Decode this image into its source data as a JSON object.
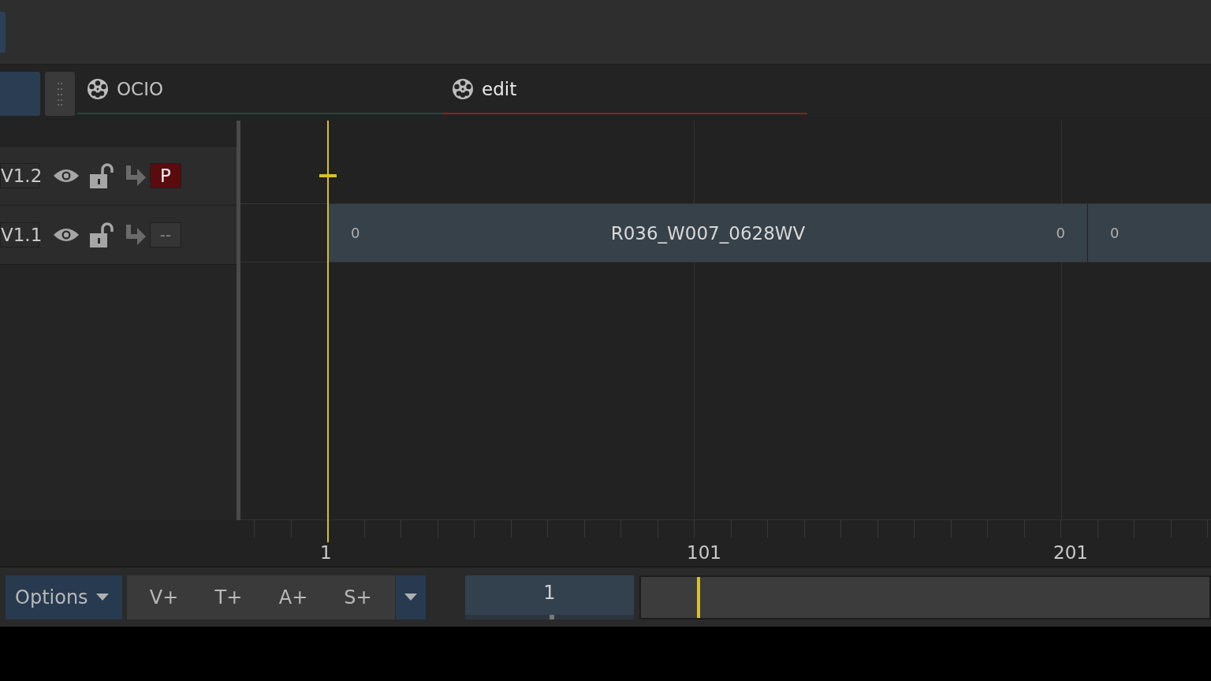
{
  "tabs": [
    {
      "label": "OCIO",
      "selected": false,
      "color": "#1c4a3a"
    },
    {
      "label": "edit",
      "selected": true,
      "color": "#8a1f25"
    }
  ],
  "tracks": [
    {
      "name": "V1.2",
      "patch": {
        "label": "P",
        "active": true
      }
    },
    {
      "name": "V1.1",
      "patch": {
        "label": "--",
        "active": false
      },
      "clips": [
        {
          "title": "R036_W007_0628WV",
          "head": "0",
          "tail": "0"
        },
        {
          "head": "0"
        }
      ]
    }
  ],
  "ruler": {
    "labels": [
      "1",
      "101",
      "201"
    ]
  },
  "bottom_bar": {
    "options": "Options",
    "add_buttons": [
      "V+",
      "T+",
      "A+",
      "S+"
    ],
    "frame": {
      "value": "1",
      "level": 0.5
    },
    "scrubber": {
      "level": 0.098
    }
  }
}
